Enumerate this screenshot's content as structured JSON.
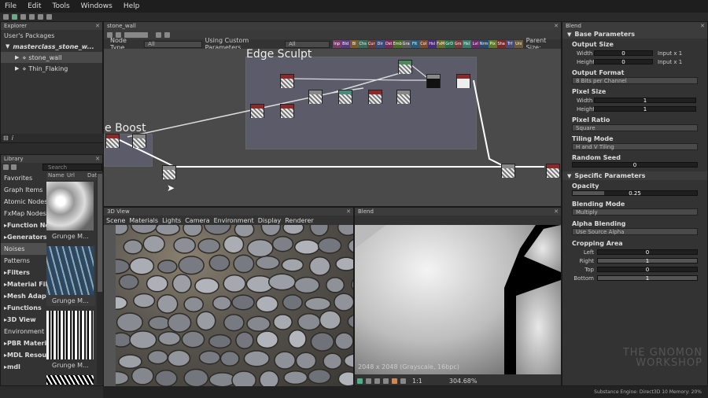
{
  "menu": [
    "File",
    "Edit",
    "Tools",
    "Windows",
    "Help"
  ],
  "explorer": {
    "title": "Explorer",
    "section": "User's Packages",
    "package": "masterclass_stone_w...",
    "items": [
      "stone_wall",
      "Thin_Flaking"
    ]
  },
  "library": {
    "title": "Library",
    "search_placeholder": "Search",
    "columns": [
      "Name",
      "Url",
      "Date"
    ],
    "tree": [
      {
        "label": "Favorites",
        "bold": false
      },
      {
        "label": "Graph Items",
        "bold": false
      },
      {
        "label": "Atomic Nodes",
        "bold": false
      },
      {
        "label": "FxMap Nodes",
        "bold": false
      },
      {
        "label": "Function Nodes",
        "bold": true
      },
      {
        "label": "Generators",
        "bold": true
      },
      {
        "label": "Noises",
        "bold": false
      },
      {
        "label": "Patterns",
        "bold": false
      },
      {
        "label": "Filters",
        "bold": true
      },
      {
        "label": "Material Filters",
        "bold": true
      },
      {
        "label": "Mesh Adaptive",
        "bold": true
      },
      {
        "label": "Functions",
        "bold": true
      },
      {
        "label": "3D View",
        "bold": true
      },
      {
        "label": "Environment",
        "bold": false
      },
      {
        "label": "PBR Materials",
        "bold": true
      },
      {
        "label": "MDL Resources",
        "bold": true
      },
      {
        "label": "mdl",
        "bold": true
      }
    ],
    "thumbs": [
      "Grunge M...",
      "Grunge M...",
      "Grunge M..."
    ]
  },
  "graph": {
    "tab": "stone_wall",
    "node_type_label": "Node Type",
    "node_type_value": "All",
    "custom_params_label": "Using Custom Parameters",
    "custom_params_value": "All",
    "parent_size_label": "Parent Size:",
    "frame1_title": "Edge Sculpt",
    "frame2_title": "e Boost",
    "filter_tags": [
      "Inp",
      "Bld",
      "Bl",
      "Chs",
      "Cur",
      "Dir",
      "Dst",
      "Emb",
      "Gra",
      "Flt",
      "Col",
      "Hsl",
      "FxM",
      "GrD",
      "Grs",
      "Hsl",
      "Lvl",
      "Nrm",
      "Pix",
      "Sha",
      "Trf",
      "Uni"
    ]
  },
  "view3d": {
    "title": "3D View",
    "menu": [
      "Scene",
      "Materials",
      "Lights",
      "Camera",
      "Environment",
      "Display",
      "Renderer"
    ]
  },
  "view2d": {
    "title": "Blend",
    "info": "2048 x 2048 (Grayscale, 16bpc)",
    "zoom": "304.68%",
    "ratio": "1:1"
  },
  "params": {
    "title": "Blend",
    "base_section": "Base Parameters",
    "output_size": "Output Size",
    "width_label": "Width",
    "width_val": "0",
    "height_label": "Height",
    "height_val": "0",
    "relative": "Input x 1",
    "output_format": "Output Format",
    "output_format_val": "8 Bits per Channel",
    "pixel_size": "Pixel Size",
    "ps_width": "1",
    "ps_height": "1",
    "pixel_ratio": "Pixel Ratio",
    "pixel_ratio_val": "Square",
    "tiling_mode": "Tiling Mode",
    "tiling_mode_val": "H and V Tiling",
    "random_seed": "Random Seed",
    "random_seed_val": "0",
    "specific_section": "Specific Parameters",
    "opacity": "Opacity",
    "opacity_val": "0.25",
    "blending_mode": "Blending Mode",
    "blending_mode_val": "Multiply",
    "alpha_blending": "Alpha Blending",
    "alpha_blending_val": "Use Source Alpha",
    "cropping_area": "Cropping Area",
    "left_label": "Left",
    "left_val": "0",
    "right_label": "Right",
    "right_val": "1",
    "top_label": "Top",
    "top_val": "0",
    "bottom_label": "Bottom",
    "bottom_val": "1"
  },
  "status": "Substance Engine: Direct3D 10  Memory: 20%",
  "watermark": "THE GNOMON WORKSHOP",
  "colors": {
    "accent": "#8a2a2a",
    "selection": "#4a4a4a"
  }
}
